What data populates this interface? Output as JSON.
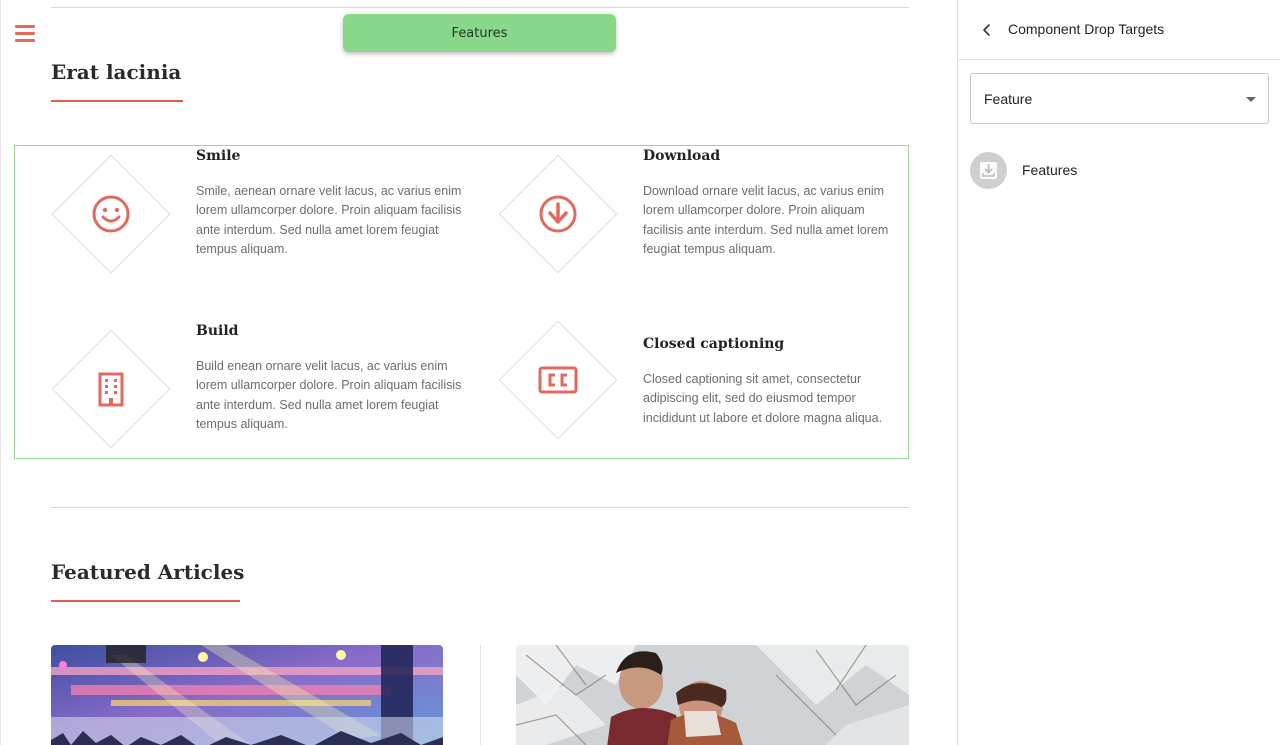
{
  "toolbar": {
    "menu_icon": "hamburger-icon",
    "drag_label": "Features"
  },
  "section1": {
    "title": "Erat lacinia",
    "features": [
      {
        "icon": "smile-icon",
        "title": "Smile",
        "text": "Smile, aenean ornare velit lacus, ac varius enim lorem ullamcorper dolore. Proin aliquam facilisis ante interdum. Sed nulla amet lorem feugiat tempus aliquam."
      },
      {
        "icon": "download-icon",
        "title": "Download",
        "text": "Download ornare velit lacus, ac varius enim lorem ullamcorper dolore. Proin aliquam facilisis ante interdum. Sed nulla amet lorem feugiat tempus aliquam."
      },
      {
        "icon": "building-icon",
        "title": "Build",
        "text": "Build enean ornare velit lacus, ac varius enim lorem ullamcorper dolore. Proin aliquam facilisis ante interdum. Sed nulla amet lorem feugiat tempus aliquam."
      },
      {
        "icon": "closed-captioning-icon",
        "title": "Closed captioning",
        "text": "Closed captioning sit amet, consectetur adipiscing elit, sed do eiusmod tempor incididunt ut labore et dolore magna aliqua."
      }
    ]
  },
  "section2": {
    "title": "Featured Articles"
  },
  "panel": {
    "back_icon": "chevron-left-icon",
    "title": "Component Drop Targets",
    "select": {
      "value": "Feature"
    },
    "targets": [
      {
        "icon": "drop-target-icon",
        "label": "Features"
      }
    ]
  },
  "colors": {
    "accent": "#e55b4d",
    "drag_pill": "#88d78b",
    "drop_zone_border": "#9ed69a",
    "icon": "#e06a60"
  }
}
